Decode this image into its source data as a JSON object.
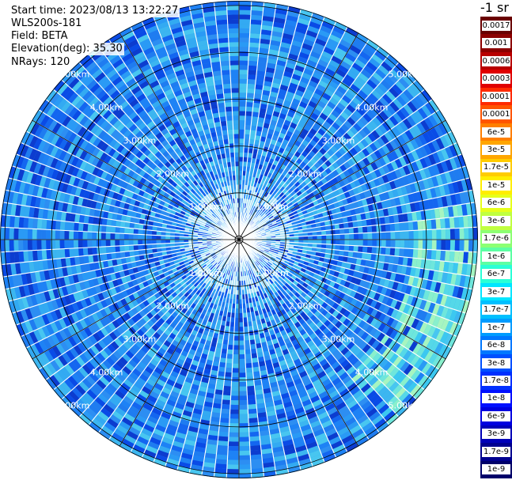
{
  "info": {
    "start_time": "Start time: 2023/08/13 13:22:27",
    "instrument": "WLS200s-181",
    "field": "Field: BETA",
    "elevation": "Elevation(deg): 35.30",
    "nrays": "NRays: 120"
  },
  "colorbar": {
    "title": "-1 sr",
    "labels": [
      "0.0017",
      "0.001",
      "0.0006",
      "0.0003",
      "0.00017",
      "0.0001",
      "6e-5",
      "3e-5",
      "1.7e-5",
      "1e-5",
      "6e-6",
      "3e-6",
      "1.7e-6",
      "1e-6",
      "6e-7",
      "3e-7",
      "1.7e-7",
      "1e-7",
      "6e-8",
      "3e-8",
      "1.7e-8",
      "1e-8",
      "6e-9",
      "3e-9",
      "1.7e-9",
      "1e-9"
    ],
    "colors": [
      "#6a0000",
      "#8c0000",
      "#b80000",
      "#e00000",
      "#ff2a00",
      "#ff5500",
      "#ff7f00",
      "#ffa600",
      "#ffcc00",
      "#ffee00",
      "#e6ff1a",
      "#c0ff40",
      "#8cff73",
      "#5cffa3",
      "#2affd6",
      "#00e6ff",
      "#00c0ff",
      "#009cff",
      "#0078ff",
      "#0050ff",
      "#0030ff",
      "#0010ff",
      "#0000e0",
      "#0000b8",
      "#000090",
      "#00006a"
    ]
  },
  "range_labels": [
    "1.00km",
    "2.00km",
    "3.00km",
    "4.00km",
    "5.00km"
  ],
  "chart_data": {
    "type": "heatmap",
    "projection": "polar PPI",
    "field": "BETA",
    "units": "-1 sr",
    "elevation_deg": 35.3,
    "n_rays": 120,
    "range_rings_km": [
      1.0,
      2.0,
      3.0,
      4.0,
      5.0
    ],
    "max_range_km": 5.1,
    "azimuth_spokes_deg": [
      0,
      30,
      60,
      90,
      120,
      150,
      180,
      210,
      240,
      270,
      300,
      330
    ],
    "color_scale": "log",
    "value_range": [
      1e-09,
      0.0017
    ],
    "dominant_range": [
      3e-08,
      3e-07
    ],
    "enhanced_sector": {
      "azimuth_deg": [
        80,
        140
      ],
      "range_km": [
        3.8,
        5.1
      ],
      "approx_value": 1e-06
    }
  }
}
